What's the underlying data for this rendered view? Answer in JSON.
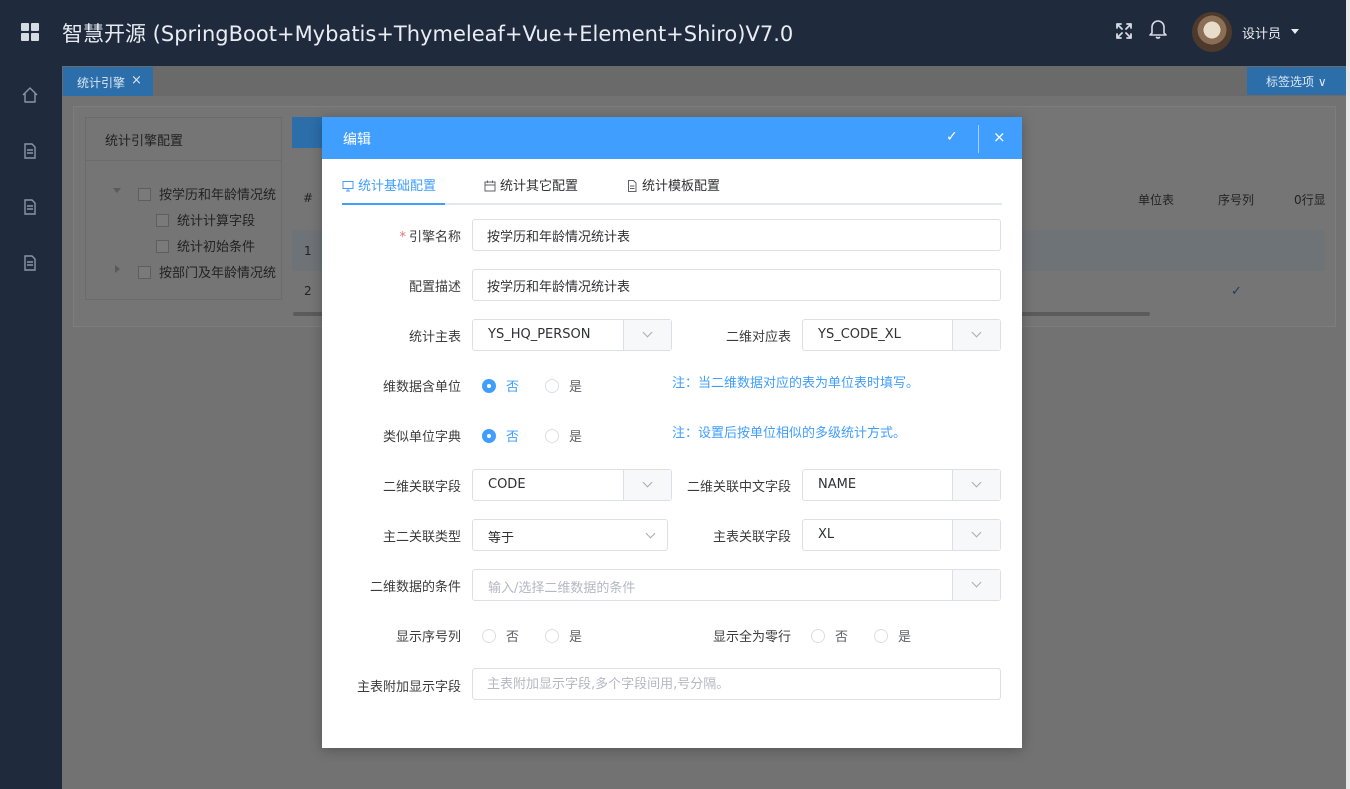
{
  "header": {
    "app_title": "智慧开源 (SpringBoot+Mybatis+Thymeleaf+Vue+Element+Shiro)V7.0",
    "user_name": "设计员"
  },
  "tabs": {
    "active_label": "统计引擎",
    "close_glyph": "×",
    "options_label": "标签选项 ∨"
  },
  "background": {
    "tree_title": "统计引擎配置",
    "tree_items": [
      "按学历和年龄情况统",
      "统计计算字段",
      "统计初始条件",
      "按部门及年龄情况统"
    ],
    "table_headers": {
      "index": "#",
      "unit_table": "单位表",
      "seq_col": "序号列",
      "zero_row": "0行显"
    },
    "rows": [
      "1",
      "2"
    ],
    "check_glyph": "✓"
  },
  "modal": {
    "title": "编辑",
    "confirm_glyph": "✓",
    "close_glyph": "×",
    "tabs": [
      "统计基础配置",
      "统计其它配置",
      "统计模板配置"
    ],
    "form": {
      "engine_name": {
        "label": "引擎名称",
        "required_mark": "*",
        "value": "按学历和年龄情况统计表"
      },
      "description": {
        "label": "配置描述",
        "value": "按学历和年龄情况统计表"
      },
      "main_table": {
        "label": "统计主表",
        "value": "YS_HQ_PERSON"
      },
      "dim2_table": {
        "label": "二维对应表",
        "value": "YS_CODE_XL"
      },
      "dim_has_unit": {
        "label": "维数据含单位",
        "options": [
          "否",
          "是"
        ],
        "selected": "否",
        "note": "注：当二维数据对应的表为单位表时填写。"
      },
      "similar_unit_dict": {
        "label": "类似单位字典",
        "options": [
          "否",
          "是"
        ],
        "selected": "否",
        "note": "注：设置后按单位相似的多级统计方式。"
      },
      "dim2_link_field": {
        "label": "二维关联字段",
        "value": "CODE"
      },
      "dim2_cn_field": {
        "label": "二维关联中文字段",
        "value": "NAME"
      },
      "join_type": {
        "label": "主二关联类型",
        "value": "等于"
      },
      "main_link_field": {
        "label": "主表关联字段",
        "value": "XL"
      },
      "dim2_condition": {
        "label": "二维数据的条件",
        "placeholder": "输入/选择二维数据的条件"
      },
      "show_seq": {
        "label": "显示序号列",
        "options": [
          "否",
          "是"
        ]
      },
      "show_zero_rows": {
        "label": "显示全为零行",
        "options": [
          "否",
          "是"
        ]
      },
      "extra_fields": {
        "label": "主表附加显示字段",
        "placeholder": "主表附加显示字段,多个字段间用,号分隔。"
      }
    }
  },
  "colors": {
    "primary": "#409eff",
    "header_bg": "#1f2a3c",
    "required": "#f56c6c"
  }
}
